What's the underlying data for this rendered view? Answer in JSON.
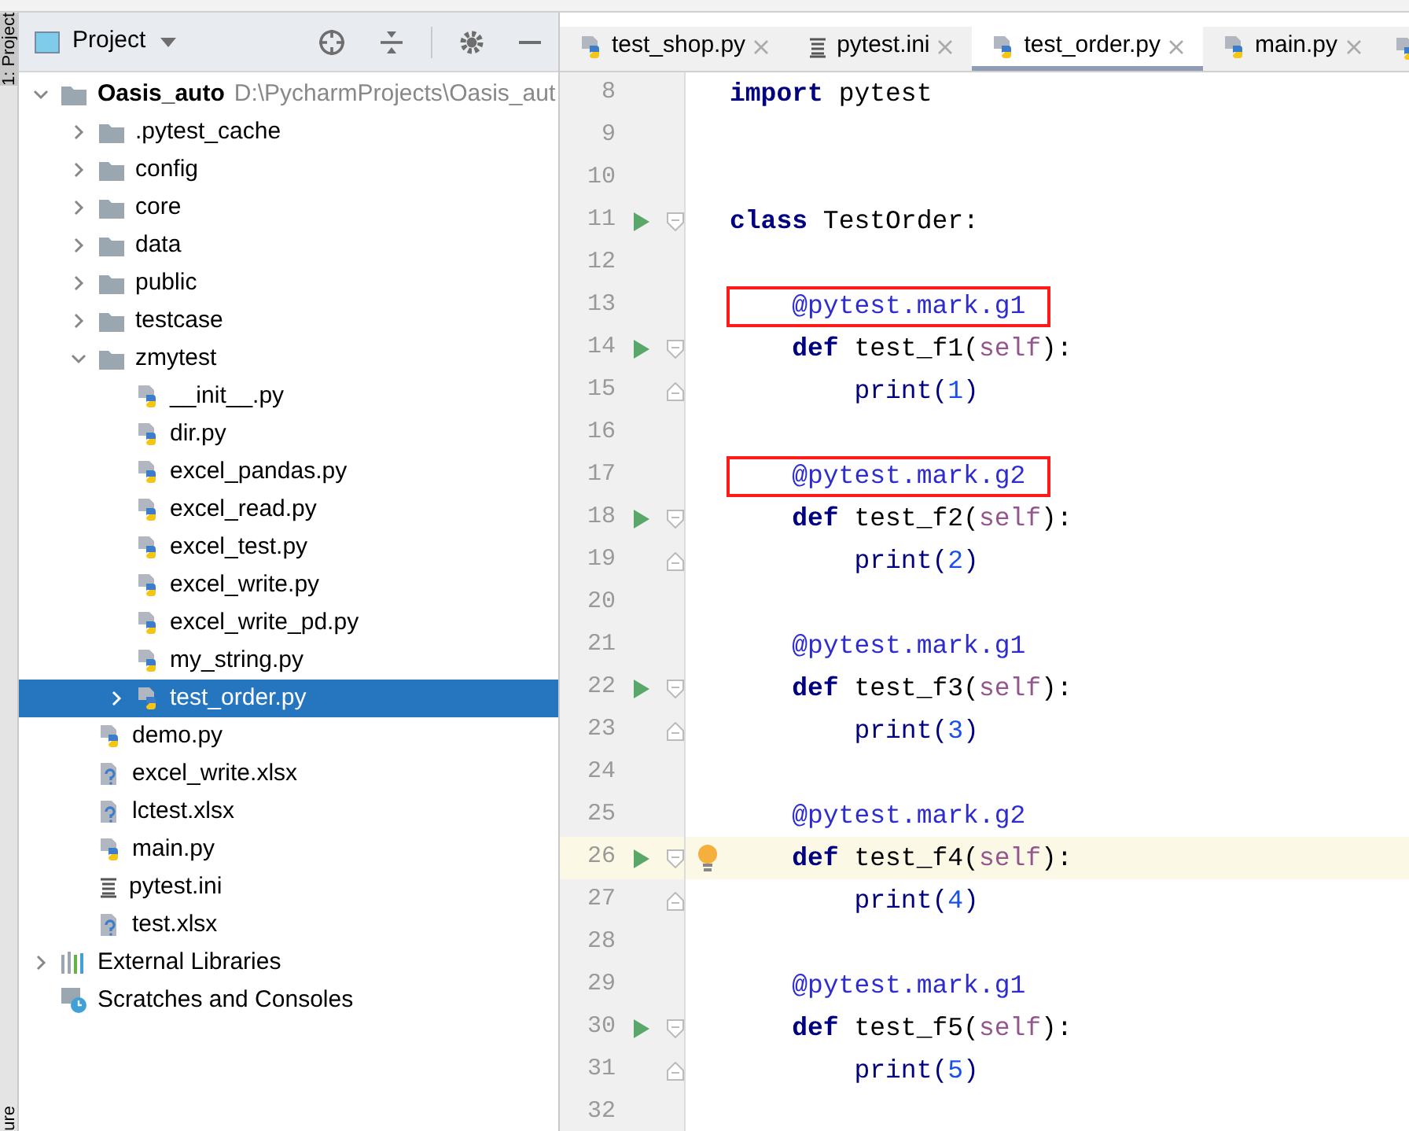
{
  "side_strip": {
    "top_label": "1: Project",
    "bottom_label": "ure"
  },
  "project_panel": {
    "title": "Project",
    "tree": [
      {
        "name": "Oasis_auto",
        "kind": "root",
        "path": "D:\\PycharmProjects\\Oasis_aut",
        "expanded": true,
        "selected": false,
        "children": [
          {
            "name": ".pytest_cache",
            "kind": "folder",
            "expanded": false,
            "selected": false
          },
          {
            "name": "config",
            "kind": "folder",
            "expanded": false,
            "selected": false
          },
          {
            "name": "core",
            "kind": "folder",
            "expanded": false,
            "selected": false
          },
          {
            "name": "data",
            "kind": "folder",
            "expanded": false,
            "selected": false
          },
          {
            "name": "public",
            "kind": "folder",
            "expanded": false,
            "selected": false
          },
          {
            "name": "testcase",
            "kind": "folder",
            "expanded": false,
            "selected": false
          },
          {
            "name": "zmytest",
            "kind": "folder",
            "expanded": true,
            "selected": false,
            "children": [
              {
                "name": "__init__.py",
                "kind": "python",
                "selected": false
              },
              {
                "name": "dir.py",
                "kind": "python",
                "selected": false
              },
              {
                "name": "excel_pandas.py",
                "kind": "python",
                "selected": false
              },
              {
                "name": "excel_read.py",
                "kind": "python",
                "selected": false
              },
              {
                "name": "excel_test.py",
                "kind": "python",
                "selected": false
              },
              {
                "name": "excel_write.py",
                "kind": "python",
                "selected": false
              },
              {
                "name": "excel_write_pd.py",
                "kind": "python",
                "selected": false
              },
              {
                "name": "my_string.py",
                "kind": "python",
                "selected": false
              },
              {
                "name": "test_order.py",
                "kind": "python",
                "expanded": false,
                "selected": true
              }
            ]
          },
          {
            "name": "demo.py",
            "kind": "python",
            "selected": false
          },
          {
            "name": "excel_write.xlsx",
            "kind": "unknown",
            "selected": false
          },
          {
            "name": "lctest.xlsx",
            "kind": "unknown",
            "selected": false
          },
          {
            "name": "main.py",
            "kind": "python",
            "selected": false
          },
          {
            "name": "pytest.ini",
            "kind": "ini",
            "selected": false
          },
          {
            "name": "test.xlsx",
            "kind": "unknown",
            "selected": false
          }
        ]
      },
      {
        "name": "External Libraries",
        "kind": "library",
        "expanded": false,
        "selected": false
      },
      {
        "name": "Scratches and Consoles",
        "kind": "scratches",
        "selected": false
      }
    ]
  },
  "tabs": [
    {
      "label": "test_shop.py",
      "kind": "python",
      "selected": false
    },
    {
      "label": "pytest.ini",
      "kind": "ini",
      "selected": false
    },
    {
      "label": "test_order.py",
      "kind": "python",
      "selected": true
    },
    {
      "label": "main.py",
      "kind": "python",
      "selected": false
    }
  ],
  "editor": {
    "lines": [
      {
        "number": "8",
        "run": false,
        "fold_open": false,
        "fold_close": false,
        "current": false,
        "bulb": false,
        "boxed": false,
        "segments": [
          {
            "kind": "keyword",
            "text": "import"
          },
          {
            "kind": "plain",
            "text": " pytest"
          }
        ]
      },
      {
        "number": "9",
        "run": false,
        "fold_open": false,
        "fold_close": false,
        "current": false,
        "bulb": false,
        "boxed": false
      },
      {
        "number": "10",
        "run": false,
        "fold_open": false,
        "fold_close": false,
        "current": false,
        "bulb": false,
        "boxed": false
      },
      {
        "number": "11",
        "run": true,
        "fold_open": true,
        "fold_close": false,
        "current": false,
        "bulb": false,
        "boxed": false,
        "segments": [
          {
            "kind": "keyword",
            "text": "class"
          },
          {
            "kind": "plain",
            "text": " TestOrder:"
          }
        ]
      },
      {
        "number": "12",
        "run": false,
        "fold_open": false,
        "fold_close": false,
        "current": false,
        "bulb": false,
        "boxed": false
      },
      {
        "number": "13",
        "run": false,
        "fold_open": false,
        "fold_close": false,
        "current": false,
        "bulb": false,
        "boxed": true,
        "segments": [
          {
            "kind": "decorator",
            "text": "    @pytest.mark.g1"
          }
        ]
      },
      {
        "number": "14",
        "run": true,
        "fold_open": true,
        "fold_close": false,
        "current": false,
        "bulb": false,
        "boxed": false,
        "segments": [
          {
            "kind": "keyword",
            "text": "    def"
          },
          {
            "kind": "plain",
            "text": " test_f1("
          },
          {
            "kind": "self",
            "text": "self"
          },
          {
            "kind": "plain",
            "text": "):"
          }
        ]
      },
      {
        "number": "15",
        "run": false,
        "fold_open": false,
        "fold_close": true,
        "current": false,
        "bulb": false,
        "boxed": false,
        "segments": [
          {
            "kind": "call",
            "text": "        print("
          },
          {
            "kind": "number",
            "text": "1"
          },
          {
            "kind": "call",
            "text": ")"
          }
        ]
      },
      {
        "number": "16",
        "run": false,
        "fold_open": false,
        "fold_close": false,
        "current": false,
        "bulb": false,
        "boxed": false
      },
      {
        "number": "17",
        "run": false,
        "fold_open": false,
        "fold_close": false,
        "current": false,
        "bulb": false,
        "boxed": true,
        "segments": [
          {
            "kind": "decorator",
            "text": "    @pytest.mark.g2"
          }
        ]
      },
      {
        "number": "18",
        "run": true,
        "fold_open": true,
        "fold_close": false,
        "current": false,
        "bulb": false,
        "boxed": false,
        "segments": [
          {
            "kind": "keyword",
            "text": "    def"
          },
          {
            "kind": "plain",
            "text": " test_f2("
          },
          {
            "kind": "self",
            "text": "self"
          },
          {
            "kind": "plain",
            "text": "):"
          }
        ]
      },
      {
        "number": "19",
        "run": false,
        "fold_open": false,
        "fold_close": true,
        "current": false,
        "bulb": false,
        "boxed": false,
        "segments": [
          {
            "kind": "call",
            "text": "        print("
          },
          {
            "kind": "number",
            "text": "2"
          },
          {
            "kind": "call",
            "text": ")"
          }
        ]
      },
      {
        "number": "20",
        "run": false,
        "fold_open": false,
        "fold_close": false,
        "current": false,
        "bulb": false,
        "boxed": false
      },
      {
        "number": "21",
        "run": false,
        "fold_open": false,
        "fold_close": false,
        "current": false,
        "bulb": false,
        "boxed": false,
        "segments": [
          {
            "kind": "decorator",
            "text": "    @pytest.mark.g1"
          }
        ]
      },
      {
        "number": "22",
        "run": true,
        "fold_open": true,
        "fold_close": false,
        "current": false,
        "bulb": false,
        "boxed": false,
        "segments": [
          {
            "kind": "keyword",
            "text": "    def"
          },
          {
            "kind": "plain",
            "text": " test_f3("
          },
          {
            "kind": "self",
            "text": "self"
          },
          {
            "kind": "plain",
            "text": "):"
          }
        ]
      },
      {
        "number": "23",
        "run": false,
        "fold_open": false,
        "fold_close": true,
        "current": false,
        "bulb": false,
        "boxed": false,
        "segments": [
          {
            "kind": "call",
            "text": "        print("
          },
          {
            "kind": "number",
            "text": "3"
          },
          {
            "kind": "call",
            "text": ")"
          }
        ]
      },
      {
        "number": "24",
        "run": false,
        "fold_open": false,
        "fold_close": false,
        "current": false,
        "bulb": false,
        "boxed": false
      },
      {
        "number": "25",
        "run": false,
        "fold_open": false,
        "fold_close": false,
        "current": false,
        "bulb": false,
        "boxed": false,
        "segments": [
          {
            "kind": "decorator",
            "text": "    @pytest.mark.g2"
          }
        ]
      },
      {
        "number": "26",
        "run": true,
        "fold_open": true,
        "fold_close": false,
        "current": true,
        "bulb": true,
        "boxed": false,
        "segments": [
          {
            "kind": "keyword",
            "text": "    def"
          },
          {
            "kind": "plain",
            "text": " test_f4("
          },
          {
            "kind": "self",
            "text": "self"
          },
          {
            "kind": "plain",
            "text": "):"
          }
        ]
      },
      {
        "number": "27",
        "run": false,
        "fold_open": false,
        "fold_close": true,
        "current": false,
        "bulb": false,
        "boxed": false,
        "segments": [
          {
            "kind": "call",
            "text": "        print("
          },
          {
            "kind": "number",
            "text": "4"
          },
          {
            "kind": "call",
            "text": ")"
          }
        ]
      },
      {
        "number": "28",
        "run": false,
        "fold_open": false,
        "fold_close": false,
        "current": false,
        "bulb": false,
        "boxed": false
      },
      {
        "number": "29",
        "run": false,
        "fold_open": false,
        "fold_close": false,
        "current": false,
        "bulb": false,
        "boxed": false,
        "segments": [
          {
            "kind": "decorator",
            "text": "    @pytest.mark.g1"
          }
        ]
      },
      {
        "number": "30",
        "run": true,
        "fold_open": true,
        "fold_close": false,
        "current": false,
        "bulb": false,
        "boxed": false,
        "segments": [
          {
            "kind": "keyword",
            "text": "    def"
          },
          {
            "kind": "plain",
            "text": " test_f5("
          },
          {
            "kind": "self",
            "text": "self"
          },
          {
            "kind": "plain",
            "text": "):"
          }
        ]
      },
      {
        "number": "31",
        "run": false,
        "fold_open": false,
        "fold_close": true,
        "current": false,
        "bulb": false,
        "boxed": false,
        "segments": [
          {
            "kind": "call",
            "text": "        print("
          },
          {
            "kind": "number",
            "text": "5"
          },
          {
            "kind": "call",
            "text": ")"
          }
        ]
      },
      {
        "number": "32",
        "run": false,
        "fold_open": false,
        "fold_close": false,
        "current": false,
        "bulb": false,
        "boxed": false
      }
    ]
  }
}
